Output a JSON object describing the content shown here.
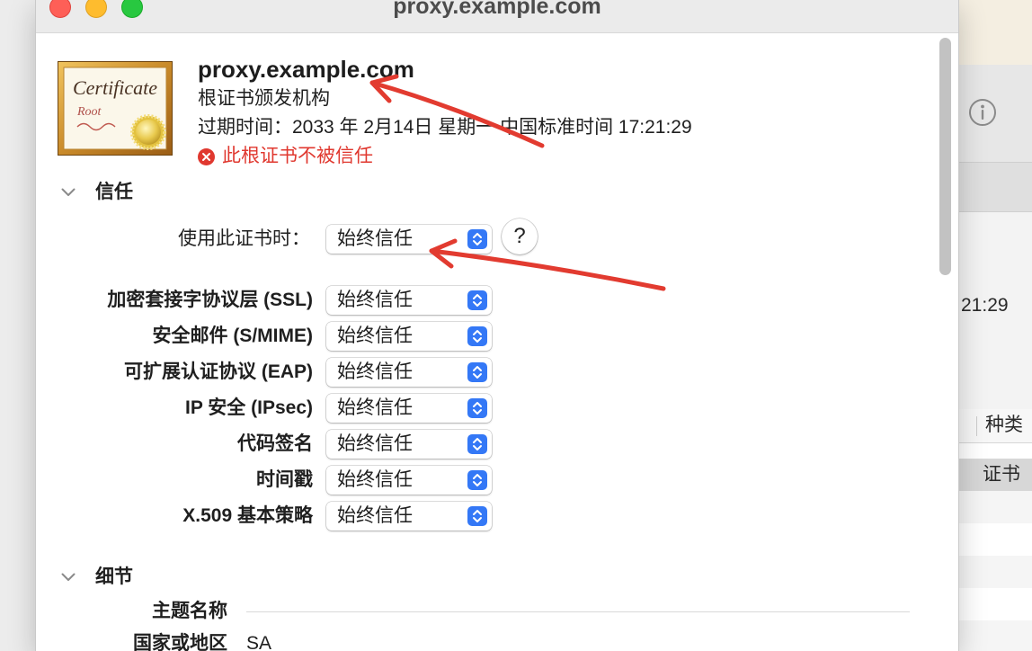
{
  "window": {
    "title": "proxy.example.com"
  },
  "cert": {
    "icon": {
      "title": "Certificate",
      "subtitle": "Root"
    },
    "name": "proxy.example.com",
    "kind": "根证书颁发机构",
    "expiry": "过期时间：2033 年 2月14日 星期一 中国标准时间 17:21:29",
    "status": "此根证书不被信任"
  },
  "trust": {
    "section_title": "信任",
    "when_using": {
      "label": "使用此证书时：",
      "value": "始终信任"
    },
    "help_label": "?",
    "policies": [
      {
        "label": "加密套接字协议层 (SSL)",
        "value": "始终信任"
      },
      {
        "label": "安全邮件 (S/MIME)",
        "value": "始终信任"
      },
      {
        "label": "可扩展认证协议 (EAP)",
        "value": "始终信任"
      },
      {
        "label": "IP 安全 (IPsec)",
        "value": "始终信任"
      },
      {
        "label": "代码签名",
        "value": "始终信任"
      },
      {
        "label": "时间戳",
        "value": "始终信任"
      },
      {
        "label": "X.509 基本策略",
        "value": "始终信任"
      }
    ]
  },
  "details": {
    "section_title": "细节",
    "subject_heading": "主题名称",
    "fields": [
      {
        "label": "国家或地区",
        "value": "SA"
      }
    ]
  },
  "behind_window": {
    "time_fragment": "21:29",
    "column_header": "种类",
    "selected_row": "证书"
  },
  "colors": {
    "accent": "#3478f6",
    "error": "#e0382f",
    "annotation_arrow": "#e23b30",
    "traffic_close": "#fe5f57",
    "traffic_minimize": "#febc2e",
    "traffic_zoom": "#28c840"
  },
  "icons": {
    "certificate": "certificate-root-icon",
    "status": "error-circle-icon",
    "disclosure": "chevron-down-icon",
    "popup": "up-down-stepper-icon",
    "help": "help-icon",
    "info": "info-icon"
  }
}
